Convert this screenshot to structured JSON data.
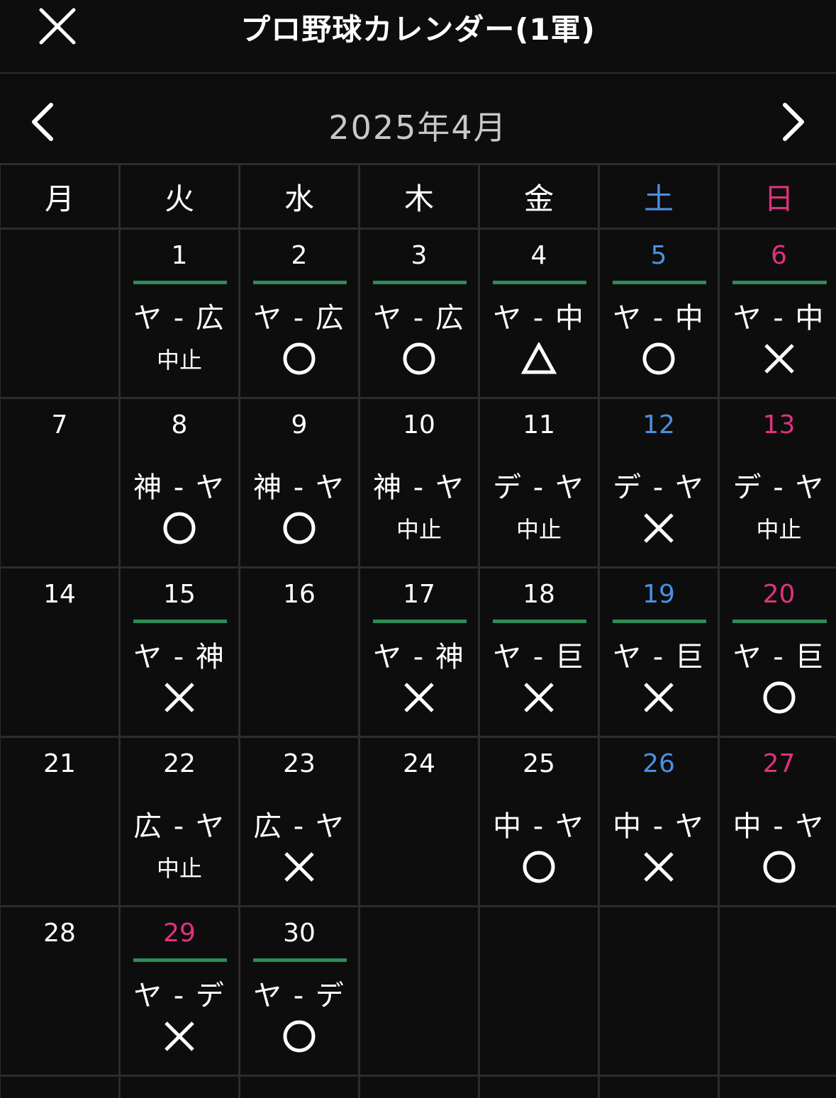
{
  "header": {
    "title": "プロ野球カレンダー(1軍)"
  },
  "nav": {
    "month_label": "2025年4月"
  },
  "weekdays": [
    "月",
    "火",
    "水",
    "木",
    "金",
    "土",
    "日"
  ],
  "colors": {
    "saturday": "#4a90e2",
    "sunday": "#e0327f",
    "game_line": "#2e8b57"
  },
  "days": [
    {
      "day": "1",
      "col": 2,
      "home": true,
      "matchup": "ヤ - 広",
      "result": "中止"
    },
    {
      "day": "2",
      "col": 3,
      "home": true,
      "matchup": "ヤ - 広",
      "result": "○"
    },
    {
      "day": "3",
      "col": 4,
      "home": true,
      "matchup": "ヤ - 広",
      "result": "○"
    },
    {
      "day": "4",
      "col": 5,
      "home": true,
      "matchup": "ヤ - 中",
      "result": "△"
    },
    {
      "day": "5",
      "col": 6,
      "home": true,
      "matchup": "ヤ - 中",
      "result": "○"
    },
    {
      "day": "6",
      "col": 7,
      "home": true,
      "matchup": "ヤ - 中",
      "result": "×"
    },
    {
      "day": "7",
      "col": 1
    },
    {
      "day": "8",
      "col": 2,
      "home": false,
      "matchup": "神 - ヤ",
      "result": "○"
    },
    {
      "day": "9",
      "col": 3,
      "home": false,
      "matchup": "神 - ヤ",
      "result": "○"
    },
    {
      "day": "10",
      "col": 4,
      "home": false,
      "matchup": "神 - ヤ",
      "result": "中止"
    },
    {
      "day": "11",
      "col": 5,
      "home": false,
      "matchup": "デ - ヤ",
      "result": "中止"
    },
    {
      "day": "12",
      "col": 6,
      "home": false,
      "matchup": "デ - ヤ",
      "result": "×"
    },
    {
      "day": "13",
      "col": 7,
      "home": false,
      "matchup": "デ - ヤ",
      "result": "中止"
    },
    {
      "day": "14",
      "col": 1
    },
    {
      "day": "15",
      "col": 2,
      "home": true,
      "matchup": "ヤ - 神",
      "result": "×"
    },
    {
      "day": "16",
      "col": 3
    },
    {
      "day": "17",
      "col": 4,
      "home": true,
      "matchup": "ヤ - 神",
      "result": "×"
    },
    {
      "day": "18",
      "col": 5,
      "home": true,
      "matchup": "ヤ - 巨",
      "result": "×"
    },
    {
      "day": "19",
      "col": 6,
      "home": true,
      "matchup": "ヤ - 巨",
      "result": "×"
    },
    {
      "day": "20",
      "col": 7,
      "home": true,
      "matchup": "ヤ - 巨",
      "result": "○"
    },
    {
      "day": "21",
      "col": 1
    },
    {
      "day": "22",
      "col": 2,
      "home": false,
      "matchup": "広 - ヤ",
      "result": "中止"
    },
    {
      "day": "23",
      "col": 3,
      "home": false,
      "matchup": "広 - ヤ",
      "result": "×"
    },
    {
      "day": "24",
      "col": 4
    },
    {
      "day": "25",
      "col": 5,
      "home": false,
      "matchup": "中 - ヤ",
      "result": "○"
    },
    {
      "day": "26",
      "col": 6,
      "home": false,
      "matchup": "中 - ヤ",
      "result": "×"
    },
    {
      "day": "27",
      "col": 7,
      "home": false,
      "matchup": "中 - ヤ",
      "result": "○"
    },
    {
      "day": "28",
      "col": 1
    },
    {
      "day": "29",
      "col": 2,
      "home": true,
      "holiday": true,
      "matchup": "ヤ - デ",
      "result": "×"
    },
    {
      "day": "30",
      "col": 3,
      "home": true,
      "matchup": "ヤ - デ",
      "result": "○"
    }
  ]
}
